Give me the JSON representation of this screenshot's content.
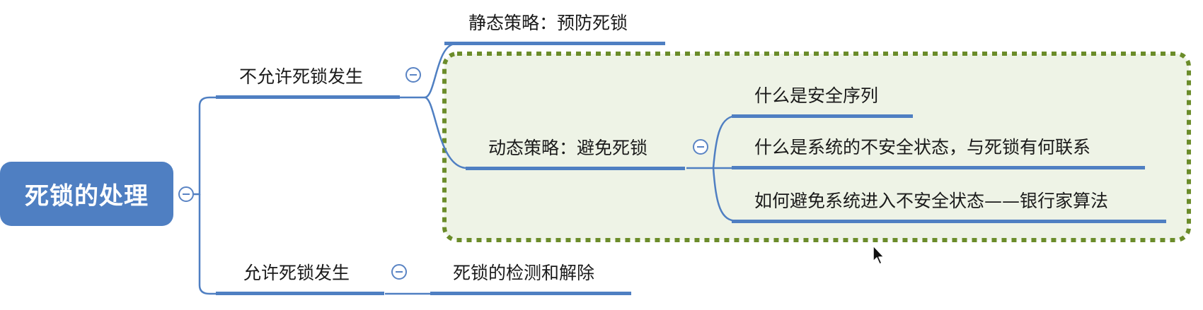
{
  "mindmap": {
    "root": {
      "label": "死锁的处理"
    },
    "branches": [
      {
        "label": "不允许死锁发生",
        "children": [
          {
            "label": "静态策略：预防死锁"
          },
          {
            "label": "动态策略：避免死锁",
            "children": [
              {
                "label": "什么是安全序列"
              },
              {
                "label": "什么是系统的不安全状态，与死锁有何联系"
              },
              {
                "label": "如何避免系统进入不安全状态——银行家算法"
              }
            ]
          }
        ]
      },
      {
        "label": "允许死锁发生",
        "children": [
          {
            "label": "死锁的检测和解除"
          }
        ]
      }
    ]
  },
  "colors": {
    "root_fill": "#4f7fc2",
    "line": "#4f7fc2",
    "highlight_border": "#6b8c2a",
    "highlight_fill": "#eef3e6"
  }
}
